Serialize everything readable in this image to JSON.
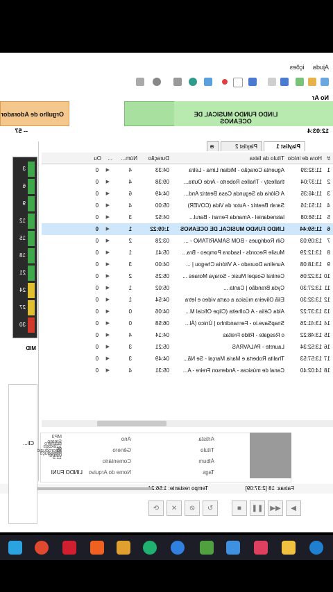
{
  "menu": {
    "items": [
      "Ajuda",
      "ições"
    ]
  },
  "header": {
    "no_ar": "No Ar",
    "current_song": "LINDO FUNDO MUSICAL DE OCEANOS",
    "next_song": "Orgulho de Adorador",
    "time_left": "12:03:4",
    "time_right": "-- 57"
  },
  "tabs": [
    "Playlist 1",
    "Playlist 2"
  ],
  "table": {
    "headers": [
      "#",
      "Hora de início",
      "Título da faixa",
      "Duração",
      "Núm...",
      "...",
      "Ou"
    ],
    "rows": [
      {
        "n": "1",
        "time": "11:32:39",
        "title": "Aguenta Coração - Midian Lima - Letra",
        "dur": "04:33",
        "num": "4",
        "ou": "0"
      },
      {
        "n": "2",
        "time": "11:37:04",
        "title": "thallesty - Thalles Roberto - Arde Outra...",
        "dur": "09:38",
        "num": "4",
        "ou": "0"
      },
      {
        "n": "3",
        "time": "11:46:35",
        "title": "A Glória da Segunda Casa  Beatriz And...",
        "dur": "04:49",
        "num": "6",
        "ou": "0"
      },
      {
        "n": "4",
        "time": "11:51:16",
        "title": "Sarah Beatriz - Autor da Vida (COVER)",
        "dur": "05:00",
        "num": "4",
        "ou": "0"
      },
      {
        "n": "5",
        "time": "11:56:08",
        "title": "laisnedaniel - Amanda Ferrari - Barul...",
        "dur": "04:52",
        "num": "3",
        "ou": "0"
      },
      {
        "n": "6",
        "time": "11:59:44",
        "title": "LINDO FUNDO MUSICAL DE OCEANOS",
        "dur": "1:09:22",
        "num": "1",
        "ou": "0",
        "selected": true
      },
      {
        "n": "7",
        "time": "13:09:03",
        "title": "Gih Rodrigues - BOM SAMARITANO - ...",
        "dur": "03:28",
        "num": "2",
        "ou": "0"
      },
      {
        "n": "8",
        "time": "13:12:29",
        "title": "Musile Records - Isadora Pompeo - Bra...",
        "dur": "05:41",
        "num": "1",
        "ou": "0"
      },
      {
        "n": "9",
        "time": "13:18:08",
        "title": "Aurelina Dourado - A Vitória Chegou | ...",
        "dur": "04:00",
        "num": "3",
        "ou": "0"
      },
      {
        "n": "10",
        "time": "13:22:06",
        "title": "Central Gospel Music - Soraya Moraes ...",
        "dur": "05:25",
        "num": "2",
        "ou": "0"
      },
      {
        "n": "11",
        "time": "13:27:30",
        "title": "Cyda Brandão | Canta ...",
        "dur": "05:02",
        "num": "1",
        "ou": "0"
      },
      {
        "n": "12",
        "time": "13:32:30",
        "title": "Eliã Oliveira  música a carta  vídeo e letra",
        "dur": "04:54",
        "num": "1",
        "ou": "0"
      },
      {
        "n": "13",
        "time": "13:37:22",
        "title": "Alda Célia - A Colheita (Clipe Oficial M...",
        "dur": "04:06",
        "num": "0",
        "ou": "0"
      },
      {
        "n": "14",
        "time": "13:41:26",
        "title": "SnapSave.io - Fernandinho | Único (Ál...",
        "dur": "06:58",
        "num": "0",
        "ou": "0"
      },
      {
        "n": "15",
        "time": "13:48:22",
        "title": "o Resgate - Rildo Freitas",
        "dur": "04:14",
        "num": "4",
        "ou": "0"
      },
      {
        "n": "16",
        "time": "13:52:34",
        "title": "Laurete - PALAVRAS",
        "dur": "05:21",
        "num": "3",
        "ou": "0"
      },
      {
        "n": "17",
        "time": "13:57:53",
        "title": "Thalita Roberta e Maria Marçal - Se Nã...",
        "dur": "04:49",
        "num": "3",
        "ou": "0"
      },
      {
        "n": "18",
        "time": "14:02:40",
        "title": "Canal de músicas - Anderson Freire - A...",
        "dur": "05:31",
        "num": "4",
        "ou": "0"
      }
    ]
  },
  "info": {
    "artista": "Artista",
    "titulo": "Título",
    "album": "Álbum",
    "tags": "Tags",
    "ano": "Ano",
    "genero": "Gênero",
    "comentario": "Comentário",
    "arquivo": "Nome do Arquivo",
    "arquivo_val": "LINDO FUNI",
    "mp3": "MP3 Stereo 128kbps 44",
    "num_repro": "Número de reproduçõ",
    "reproduzido": "Reproduzido: 03/06/",
    "hora": "11:5"
  },
  "status": {
    "faixas": "Faixas: 18 [2:37:09]",
    "tempo": "Tempo restante: 1:56:24"
  },
  "vu": {
    "labels": [
      "3",
      "6",
      "9",
      "12",
      "15",
      "18",
      "21",
      "24",
      "27",
      "30"
    ]
  },
  "side": {
    "mid": "MID",
    "cli": "Cli..."
  },
  "colors": {
    "green": "#a8e0a0",
    "orange": "#f4c78d",
    "selected": "#cfe7fb"
  }
}
